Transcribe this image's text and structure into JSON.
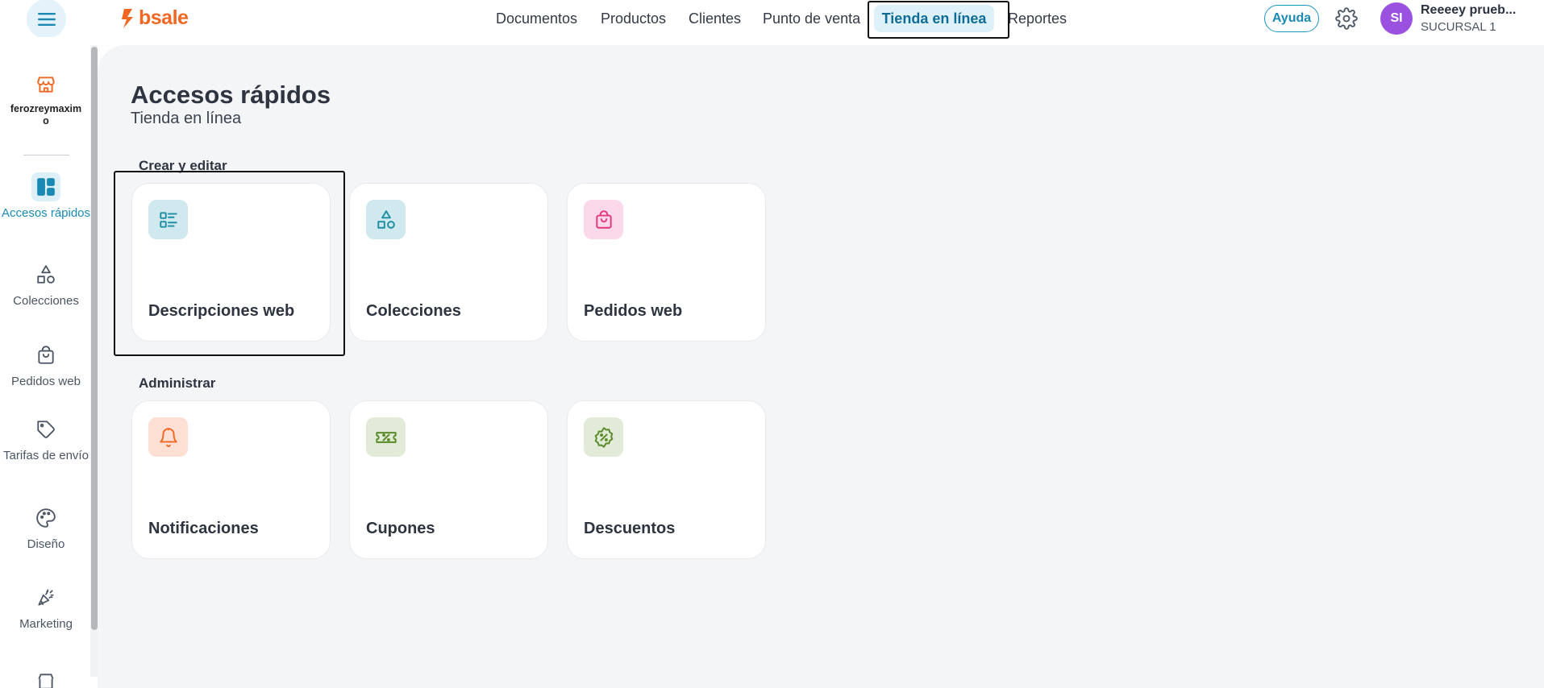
{
  "brand": {
    "name": "bsale",
    "color": "#f26722"
  },
  "topnav": {
    "items": [
      {
        "label": "Documentos"
      },
      {
        "label": "Productos"
      },
      {
        "label": "Clientes"
      },
      {
        "label": "Punto de venta"
      },
      {
        "label": "Tienda en línea"
      },
      {
        "label": "Reportes"
      }
    ],
    "active_index": 4,
    "help_label": "Ayuda"
  },
  "user": {
    "initials": "SI",
    "name": "Reeeey prueb...",
    "branch": "SUCURSAL 1"
  },
  "sidebar": {
    "store_name": "ferozreymaximo",
    "items": [
      {
        "label": "Accesos rápidos",
        "icon": "dashboard-icon",
        "active": true
      },
      {
        "label": "Colecciones",
        "icon": "shapes-icon"
      },
      {
        "label": "Pedidos web",
        "icon": "shopping-bag-icon"
      },
      {
        "label": "Tarifas de envío",
        "icon": "tag-icon"
      },
      {
        "label": "Diseño",
        "icon": "palette-icon"
      },
      {
        "label": "Marketing",
        "icon": "megaphone-icon"
      }
    ]
  },
  "main": {
    "title": "Accesos rápidos",
    "subtitle": "Tienda en línea",
    "sections": [
      {
        "title": "Crear y editar",
        "cards": [
          {
            "label": "Descripciones web",
            "icon": "list-icon",
            "icon_bg": "#cfe9ee",
            "icon_color": "#1f8ea3"
          },
          {
            "label": "Colecciones",
            "icon": "shapes-icon",
            "icon_bg": "#cfe9ee",
            "icon_color": "#1f8ea3"
          },
          {
            "label": "Pedidos web",
            "icon": "shopping-bag-icon",
            "icon_bg": "#fbd9ea",
            "icon_color": "#e0377e"
          }
        ]
      },
      {
        "title": "Administrar",
        "cards": [
          {
            "label": "Notificaciones",
            "icon": "bell-icon",
            "icon_bg": "#fde0d3",
            "icon_color": "#f26722"
          },
          {
            "label": "Cupones",
            "icon": "ticket-icon",
            "icon_bg": "#e2ead8",
            "icon_color": "#5a8a2a"
          },
          {
            "label": "Descuentos",
            "icon": "discount-badge-icon",
            "icon_bg": "#e2ead8",
            "icon_color": "#5a8a2a"
          }
        ]
      }
    ]
  }
}
